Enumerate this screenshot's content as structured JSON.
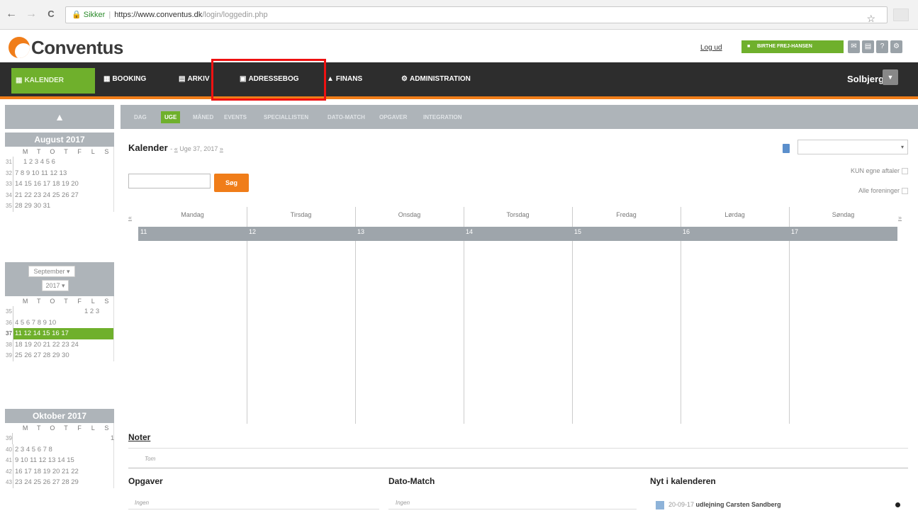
{
  "browser": {
    "back": "←",
    "forward": "→",
    "reload": "C",
    "secure_label": "Sikker",
    "url_host": "https://www.conventus.dk",
    "url_path": "/login/loggedin.php",
    "star": "☆"
  },
  "header": {
    "logo_text": "Conventus",
    "logout": "Log ud",
    "user_button": "BIRTHE FREJ-HANSEN",
    "icons": [
      "mail-icon",
      "chat-icon",
      "help-icon",
      "settings-icon"
    ]
  },
  "mainnav": {
    "items": [
      {
        "label": "KALENDER",
        "icon": "calendar-icon"
      },
      {
        "label": "BOOKING",
        "icon": "booking-icon"
      },
      {
        "label": "ARKIV",
        "icon": "folder-icon"
      },
      {
        "label": "ADRESSEBOG",
        "icon": "addressbook-icon"
      },
      {
        "label": "FINANS",
        "icon": "bank-icon"
      },
      {
        "label": "ADMINISTRATION",
        "icon": "gear-icon"
      }
    ],
    "club": "Solbjerg IF"
  },
  "subnav": {
    "items": [
      "DAG",
      "UGE",
      "MÅNED",
      "EVENTS",
      "SPECIALLISTEN",
      "DATO-MATCH",
      "OPGAVER",
      "INTEGRATION"
    ],
    "active": "UGE"
  },
  "minicals": {
    "august": {
      "title": "August 2017",
      "weekdays": [
        "M",
        "T",
        "O",
        "T",
        "F",
        "L",
        "S"
      ],
      "rows": [
        {
          "wk": "31",
          "days": "  1  2  3  4  5  6"
        },
        {
          "wk": "32",
          "days": "7  8  9 10 11 12 13"
        },
        {
          "wk": "33",
          "days": "14 15 16 17 18 19 20"
        },
        {
          "wk": "34",
          "days": "21 22 23 24 25 26 27"
        },
        {
          "wk": "35",
          "days": "28 29 30 31"
        }
      ]
    },
    "september": {
      "month_select": "September ▾",
      "year_select": "2017 ▾",
      "weekdays": [
        "M",
        "T",
        "O",
        "T",
        "F",
        "L",
        "S"
      ],
      "rows": [
        {
          "wk": "35",
          "days": "                     1  2  3"
        },
        {
          "wk": "36",
          "days": "4  5  6  7  8  9 10"
        },
        {
          "wk": "37",
          "days": "11 12   14 15 16 17"
        },
        {
          "wk": "38",
          "days": "18 19 20 21 22 23 24"
        },
        {
          "wk": "39",
          "days": "25 26 27 28 29 30"
        }
      ]
    },
    "oktober": {
      "title": "Oktober 2017",
      "weekdays": [
        "M",
        "T",
        "O",
        "T",
        "F",
        "L",
        "S"
      ],
      "rows": [
        {
          "wk": "39",
          "days": "                                    1"
        },
        {
          "wk": "40",
          "days": "2  3  4  5  6  7  8"
        },
        {
          "wk": "41",
          "days": "9 10 11 12 13 14 15"
        },
        {
          "wk": "42",
          "days": "16 17 18 19 20 21 22"
        },
        {
          "wk": "43",
          "days": "23 24 25 26 27 28 29"
        }
      ]
    }
  },
  "kalender": {
    "title": "Kalender",
    "week_prefix": "- ",
    "week_prev": "«",
    "week_label": " Uge 37, 2017 ",
    "week_next": "»",
    "search_button": "Søg",
    "select_value": "▾",
    "only_own": "KUN egne aftaler",
    "all_clubs": "Alle foreninger",
    "prev": "«",
    "next": "»",
    "days": [
      {
        "name": "Mandag",
        "date": "11"
      },
      {
        "name": "Tirsdag",
        "date": "12"
      },
      {
        "name": "Onsdag",
        "date": "13"
      },
      {
        "name": "Torsdag",
        "date": "14"
      },
      {
        "name": "Fredag",
        "date": "15"
      },
      {
        "name": "Lørdag",
        "date": "16"
      },
      {
        "name": "Søndag",
        "date": "17"
      }
    ]
  },
  "noter": {
    "title": "Noter",
    "value": "Tom"
  },
  "opgaver": {
    "title": "Opgaver",
    "value": "Ingen"
  },
  "datomatch": {
    "title": "Dato-Match",
    "value": "Ingen"
  },
  "nyt": {
    "title": "Nyt i kalenderen",
    "item_date": "20-09-17",
    "item_text": "udlejning Carsten Sandberg"
  }
}
